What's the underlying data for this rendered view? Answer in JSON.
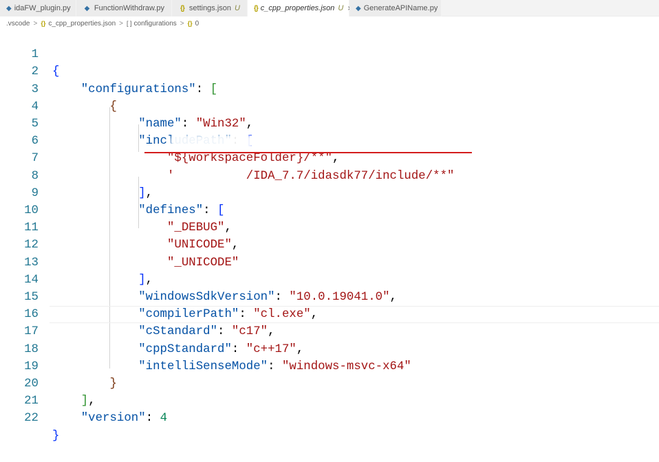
{
  "tabs": [
    {
      "label": "idaFW_plugin.py",
      "icon": "python-file-icon"
    },
    {
      "label": "FunctionWithdraw.py",
      "icon": "python-file-icon"
    },
    {
      "label": "settings.json",
      "icon": "json-file-icon",
      "modified": "U"
    },
    {
      "label": "c_cpp_properties.json",
      "icon": "json-file-icon",
      "modified": "U",
      "close": "×",
      "active": true
    },
    {
      "label": "GenerateAPIName.py",
      "icon": "python-file-icon"
    }
  ],
  "breadcrumb": {
    "folder": ".vscode",
    "file": "c_cpp_properties.json",
    "array": "configurations",
    "object": "0",
    "separator": ">"
  },
  "editor": {
    "line_numbers": [
      "1",
      "2",
      "3",
      "4",
      "5",
      "6",
      "7",
      "8",
      "9",
      "10",
      "11",
      "12",
      "13",
      "14",
      "15",
      "16",
      "17",
      "18",
      "19",
      "20",
      "21",
      "22"
    ],
    "keys": {
      "configurations": "\"configurations\"",
      "name": "\"name\"",
      "includePath": "\"includePath\"",
      "defines": "\"defines\"",
      "windowsSdkVersion": "\"windowsSdkVersion\"",
      "compilerPath": "\"compilerPath\"",
      "cStandard": "\"cStandard\"",
      "cppStandard": "\"cppStandard\"",
      "intelliSenseMode": "\"intelliSenseMode\"",
      "version": "\"version\""
    },
    "values": {
      "name": "\"Win32\"",
      "include_1": "\"${workspaceFolder}/**\"",
      "include_2_visible": "'",
      "include_2_tail": "/IDA_7.7/idasdk77/include/**\"",
      "define_1": "\"_DEBUG\"",
      "define_2": "\"UNICODE\"",
      "define_3": "\"_UNICODE\"",
      "windowsSdkVersion": "\"10.0.19041.0\"",
      "compilerPath": "\"cl.exe\"",
      "cStandard": "\"c17\"",
      "cppStandard": "\"c++17\"",
      "intelliSenseMode": "\"windows-msvc-x64\"",
      "version": "4"
    }
  },
  "colors": {
    "key": "#0451a5",
    "string": "#a31515",
    "number": "#098658",
    "line_number": "#237893",
    "annotation_underline": "#d31d1d"
  }
}
